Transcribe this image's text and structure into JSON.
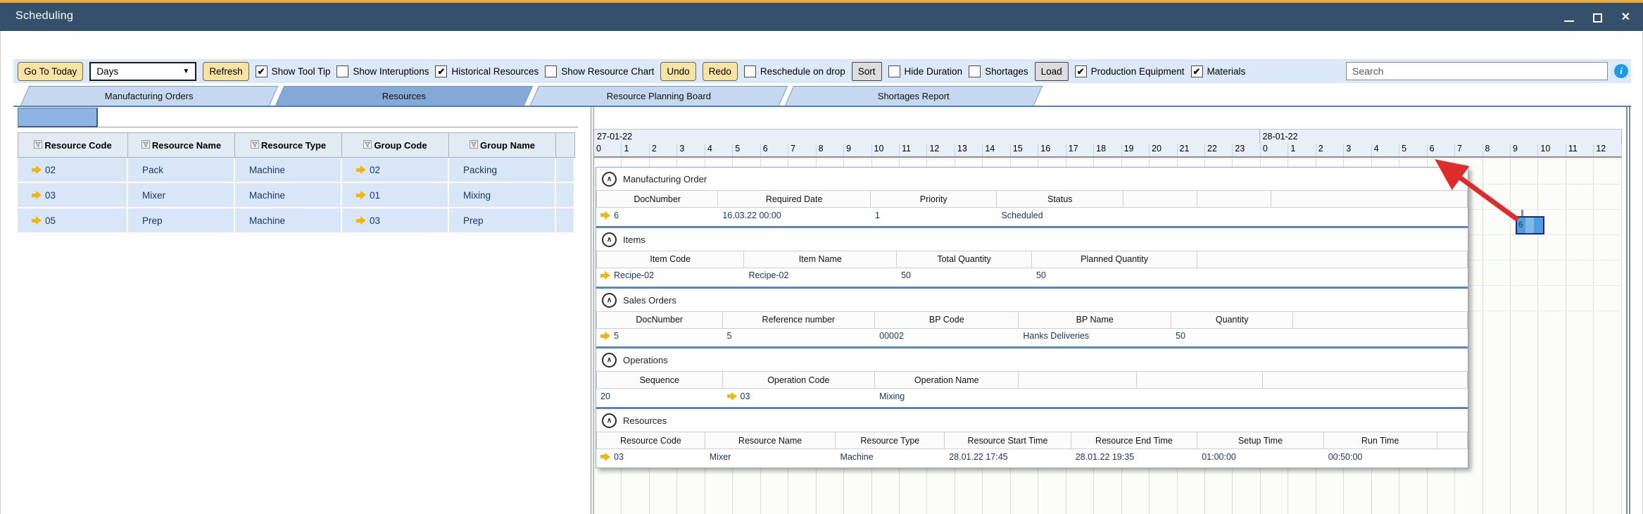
{
  "window": {
    "title": "Scheduling"
  },
  "icons": {
    "close": "✕",
    "check": "✔",
    "dropdown": "▼",
    "info": "i",
    "collapse": "∧"
  },
  "toolbar": {
    "search_placeholder": "Search",
    "items": [
      {
        "type": "button",
        "style": "yellow",
        "label": "Go To Today",
        "name": "go-to-today-button"
      },
      {
        "type": "select",
        "value": "Days",
        "name": "interval-select"
      },
      {
        "type": "button",
        "style": "yellow",
        "label": "Refresh",
        "name": "refresh-button"
      },
      {
        "type": "checkbox",
        "label": "Show Tool Tip",
        "checked": true,
        "name": "show-tool-tip-checkbox"
      },
      {
        "type": "checkbox",
        "label": "Show Interuptions",
        "checked": false,
        "name": "show-interuptions-checkbox"
      },
      {
        "type": "checkbox",
        "label": "Historical Resources",
        "checked": true,
        "name": "historical-resources-checkbox"
      },
      {
        "type": "checkbox",
        "label": "Show Resource Chart",
        "checked": false,
        "name": "show-resource-chart-checkbox"
      },
      {
        "type": "button",
        "style": "yellow",
        "label": "Undo",
        "name": "undo-button"
      },
      {
        "type": "button",
        "style": "yellow",
        "label": "Redo",
        "name": "redo-button"
      },
      {
        "type": "checkbox",
        "label": "Reschedule on drop",
        "checked": false,
        "name": "reschedule-on-drop-checkbox"
      },
      {
        "type": "button",
        "style": "gray",
        "label": "Sort",
        "name": "sort-button"
      },
      {
        "type": "checkbox",
        "label": "Hide Duration",
        "checked": false,
        "name": "hide-duration-checkbox"
      },
      {
        "type": "checkbox",
        "label": "Shortages",
        "checked": false,
        "name": "shortages-checkbox"
      },
      {
        "type": "button",
        "style": "gray",
        "label": "Load",
        "name": "load-button"
      },
      {
        "type": "checkbox",
        "label": "Production Equipment",
        "checked": true,
        "name": "production-equipment-checkbox"
      },
      {
        "type": "checkbox",
        "label": "Materials",
        "checked": true,
        "name": "materials-checkbox"
      }
    ]
  },
  "tabs": [
    {
      "label": "Manufacturing Orders",
      "selected": false
    },
    {
      "label": "Resources",
      "selected": true
    },
    {
      "label": "Resource Planning Board",
      "selected": false
    },
    {
      "label": "Shortages Report",
      "selected": false
    }
  ],
  "resource_table": {
    "columns": [
      "Resource Code",
      "Resource Name",
      "Resource Type",
      "Group Code",
      "Group Name"
    ],
    "rows": [
      [
        "02",
        "Pack",
        "Machine",
        "02",
        "Packing"
      ],
      [
        "03",
        "Mixer",
        "Machine",
        "01",
        "Mixing"
      ],
      [
        "05",
        "Prep",
        "Machine",
        "03",
        "Prep"
      ]
    ],
    "link_columns": [
      0,
      3
    ]
  },
  "gantt": {
    "days": [
      {
        "date": "27-01-22",
        "hours": [
          "0",
          "1",
          "2",
          "3",
          "4",
          "5",
          "6",
          "7",
          "8",
          "9",
          "10",
          "11",
          "12",
          "13",
          "14",
          "15",
          "16",
          "17",
          "18",
          "19",
          "20",
          "21",
          "22",
          "23"
        ]
      },
      {
        "date": "28-01-22",
        "hours": [
          "0",
          "1",
          "2",
          "3",
          "4",
          "5",
          "6",
          "7",
          "8",
          "9",
          "10",
          "11",
          "12"
        ]
      }
    ],
    "block": {
      "label": "6"
    }
  },
  "tooltip": {
    "sections": [
      {
        "title": "Manufacturing Order",
        "columns": [
          "DocNumber",
          "Required Date",
          "Priority",
          "Status",
          "",
          "",
          ""
        ],
        "values": [
          "6",
          "16.03.22 00:00",
          "1",
          "Scheduled",
          "",
          "",
          ""
        ],
        "arrow_col": 0
      },
      {
        "title": "Items",
        "columns": [
          "Item Code",
          "Item Name",
          "Total Quantity",
          "Planned Quantity",
          ""
        ],
        "values": [
          "Recipe-02",
          "Recipe-02",
          "50",
          "50",
          ""
        ],
        "arrow_col": 0
      },
      {
        "title": "Sales Orders",
        "columns": [
          "DocNumber",
          "Reference number",
          "BP Code",
          "BP Name",
          "Quantity",
          ""
        ],
        "values": [
          "5",
          "5",
          "00002",
          "Hanks Deliveries",
          "50",
          ""
        ],
        "arrow_col": 0
      },
      {
        "title": "Operations",
        "columns": [
          "Sequence",
          "Operation Code",
          "Operation Name",
          "",
          "",
          ""
        ],
        "values": [
          "20",
          "03",
          "Mixing",
          "",
          "",
          ""
        ],
        "arrow_col": 1
      },
      {
        "title": "Resources",
        "columns": [
          "Resource Code",
          "Resource Name",
          "Resource Type",
          "Resource Start Time",
          "Resource End Time",
          "Setup Time",
          "Run Time",
          ""
        ],
        "values": [
          "03",
          "Mixer",
          "Machine",
          "28.01.22 17:45",
          "28.01.22 19:35",
          "01:00:00",
          "00:50:00",
          ""
        ],
        "arrow_col": 0
      }
    ]
  }
}
